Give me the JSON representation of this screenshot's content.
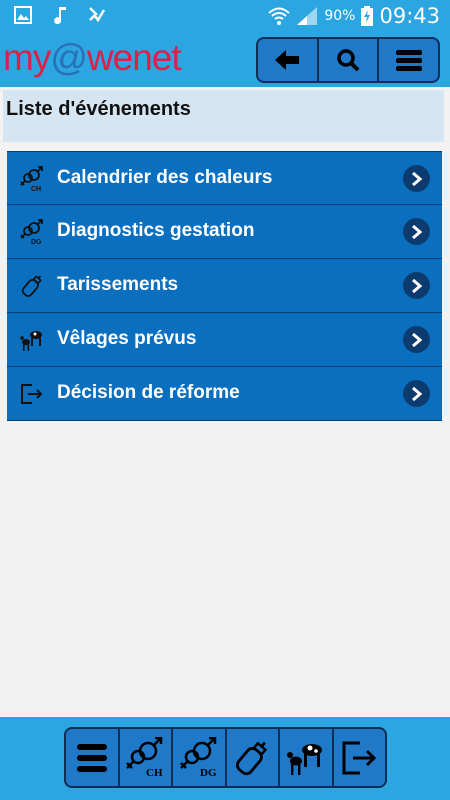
{
  "status_bar": {
    "battery_percent": "90%",
    "time": "09:43"
  },
  "app": {
    "logo_my": "my",
    "logo_at": "@",
    "logo_rest": "wenet"
  },
  "page": {
    "title": "Liste d'événements"
  },
  "events": [
    {
      "label": "Calendrier des chaleurs",
      "icon": "heat-calendar-icon",
      "icon_text": "CH"
    },
    {
      "label": "Diagnostics gestation",
      "icon": "gestation-diagnosis-icon",
      "icon_text": "DG"
    },
    {
      "label": "Tarissements",
      "icon": "bottle-icon"
    },
    {
      "label": "Vêlages prévus",
      "icon": "calving-icon"
    },
    {
      "label": "Décision de réforme",
      "icon": "exit-icon"
    }
  ],
  "bottom_nav": {
    "ch_text": "CH",
    "dg_text": "DG"
  },
  "colors": {
    "bar_blue": "#2ba6e1",
    "item_blue": "#0b6fc0",
    "dark_navy": "#0e2f55",
    "logo_red": "#d8224a"
  }
}
